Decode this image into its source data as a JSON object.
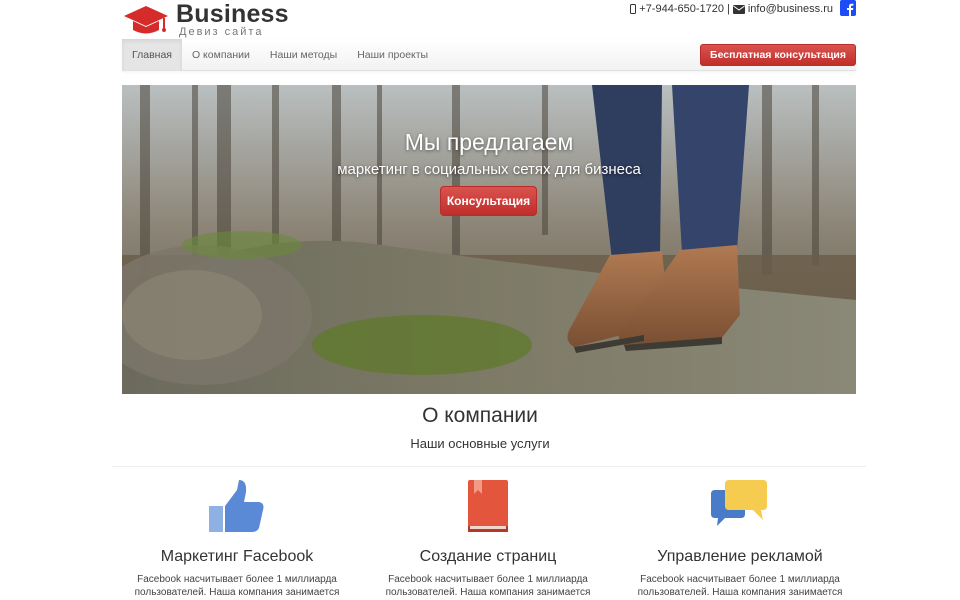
{
  "header": {
    "brand_name": "Business",
    "brand_tagline": "Девиз сайта",
    "phone": "+7-944-650-1720",
    "separator": "|",
    "email": "info@business.ru"
  },
  "nav": {
    "items": [
      {
        "label": "Главная"
      },
      {
        "label": "О компании"
      },
      {
        "label": "Наши методы"
      },
      {
        "label": "Наши проекты"
      }
    ],
    "cta_label": "Бесплатная консультация"
  },
  "hero": {
    "title": "Мы предлагаем",
    "subtitle": "маркетинг в социальных сетях для бизнеса",
    "button_label": "Консультация"
  },
  "about": {
    "title": "О компании",
    "subtitle": "Наши основные услуги"
  },
  "services": [
    {
      "icon": "thumbs-up-icon",
      "title": "Маркетинг Facebook",
      "text": "Facebook насчитывает более 1 миллиарда пользователей. Наша компания занимается изучением"
    },
    {
      "icon": "book-icon",
      "title": "Создание страниц",
      "text": "Facebook насчитывает более 1 миллиарда пользователей. Наша компания занимается изучением"
    },
    {
      "icon": "chat-bubbles-icon",
      "title": "Управление рекламой",
      "text": "Facebook насчитывает более 1 миллиарда пользователей. Наша компания занимается изучением"
    }
  ],
  "colors": {
    "brand_red": "#d9534f",
    "logo_red": "#d62b2b",
    "facebook_blue": "#1d4bf5",
    "text_dark": "#333333"
  }
}
